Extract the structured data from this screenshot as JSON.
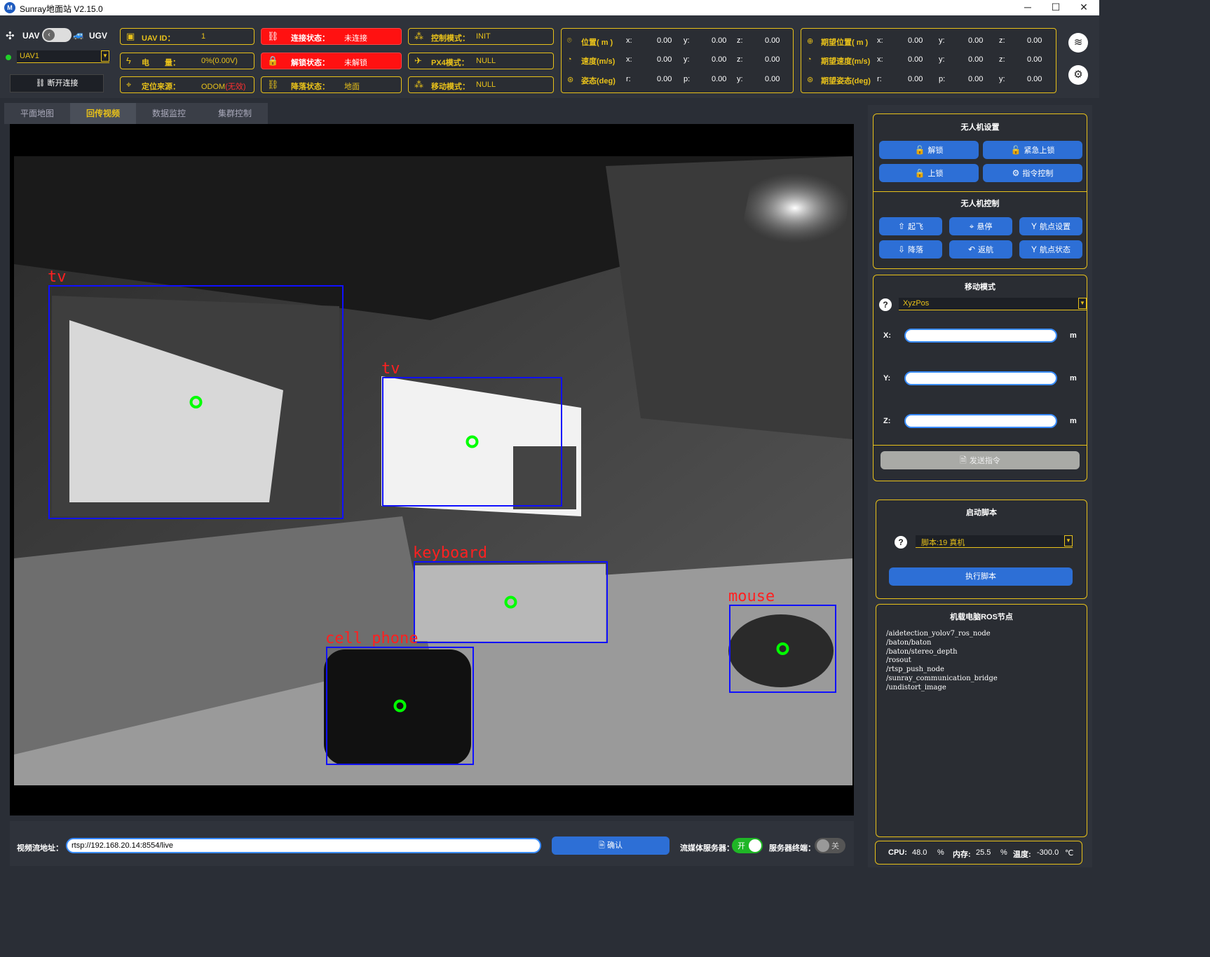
{
  "window": {
    "title": "Sunray地面站 V2.15.0",
    "minimize": "─",
    "maximize": "☐",
    "close": "✕"
  },
  "vehicle": {
    "uav_label": "UAV",
    "ugv_label": "UGV",
    "selected": "UAV1",
    "disconnect_label": "断开连接"
  },
  "status_boxes": {
    "uav_id_label": "UAV ID：",
    "uav_id_value": "1",
    "battery_label": "电　　量：",
    "battery_value": "0%(0.00V)",
    "loc_source_label": "定位来源：",
    "loc_source_value": "ODOM",
    "loc_source_flag": "(无效)",
    "conn_label": "连接状态：",
    "conn_value": "未连接",
    "lock_label": "解锁状态：",
    "lock_value": "未解锁",
    "land_label": "降落状态：",
    "land_value": "地面",
    "ctrl_mode_label": "控制模式：",
    "ctrl_mode_value": "INIT",
    "px4_label": "PX4模式：",
    "px4_value": "NULL",
    "move_mode_label": "移动模式：",
    "move_mode_value": "NULL"
  },
  "telemetry": {
    "pos_label": "位置( m )",
    "vel_label": "速度(m/s)",
    "att_label": "姿态(deg)",
    "axis_xyz": [
      "x:",
      "y:",
      "z:"
    ],
    "axis_rpy": [
      "r:",
      "p:",
      "y:"
    ],
    "pos": [
      "0.00",
      "0.00",
      "0.00"
    ],
    "vel": [
      "0.00",
      "0.00",
      "0.00"
    ],
    "att": [
      "0.00",
      "0.00",
      "0.00"
    ],
    "exp_pos_label": "期望位置( m )",
    "exp_vel_label": "期望速度(m/s)",
    "exp_att_label": "期望姿态(deg)",
    "exp_pos": [
      "0.00",
      "0.00",
      "0.00"
    ],
    "exp_vel": [
      "0.00",
      "0.00",
      "0.00"
    ],
    "exp_att": [
      "0.00",
      "0.00",
      "0.00"
    ]
  },
  "tabs": [
    "平面地图",
    "回传视频",
    "数据监控",
    "集群控制"
  ],
  "active_tab": 1,
  "detections": [
    {
      "label": "tv"
    },
    {
      "label": "tv"
    },
    {
      "label": "keyboard"
    },
    {
      "label": "cell phone"
    },
    {
      "label": "mouse"
    }
  ],
  "stream": {
    "url_label": "视频流地址：",
    "url": "rtsp://192.168.20.14:8554/live",
    "confirm_label": "确认",
    "media_server_label": "流媒体服务器：",
    "media_server_state": "开",
    "server_terminal_label": "服务器终端：",
    "server_terminal_state": "关"
  },
  "uav_settings": {
    "title": "无人机设置",
    "unlock": "解锁",
    "emergency_lock": "紧急上锁",
    "lock": "上锁",
    "cmd_control": "指令控制"
  },
  "uav_control": {
    "title": "无人机控制",
    "takeoff": "起飞",
    "hover": "悬停",
    "waypoint_set": "航点设置",
    "land": "降落",
    "return": "返航",
    "waypoint_status": "航点状态"
  },
  "move_mode": {
    "title": "移动模式",
    "selected": "XyzPos",
    "x_label": "X:",
    "y_label": "Y:",
    "z_label": "Z:",
    "unit": "m",
    "send_label": "发送指令"
  },
  "script": {
    "title": "启动脚本",
    "selected": "脚本:19 真机",
    "run_label": "执行脚本"
  },
  "ros_nodes": {
    "title": "机载电脑ROS节点",
    "items": [
      "/aidetection_yolov7_ros_node",
      "/baton/baton",
      "/baton/stereo_depth",
      "/rosout",
      "/rtsp_push_node",
      "/sunray_communication_bridge",
      "/undistort_image"
    ]
  },
  "system": {
    "cpu_label": "CPU:",
    "cpu": "48.0",
    "cpu_unit": "%",
    "mem_label": "内存:",
    "mem": "25.5",
    "mem_unit": "%",
    "temp_label": "温度:",
    "temp": "-300.0",
    "temp_unit": "℃"
  },
  "colors": {
    "accent": "#e8c11a",
    "alert": "#ff1111",
    "button": "#2d6fd6",
    "bbox": "#1010ff",
    "bbox_label": "#ff2020",
    "center": "#00ff00"
  }
}
